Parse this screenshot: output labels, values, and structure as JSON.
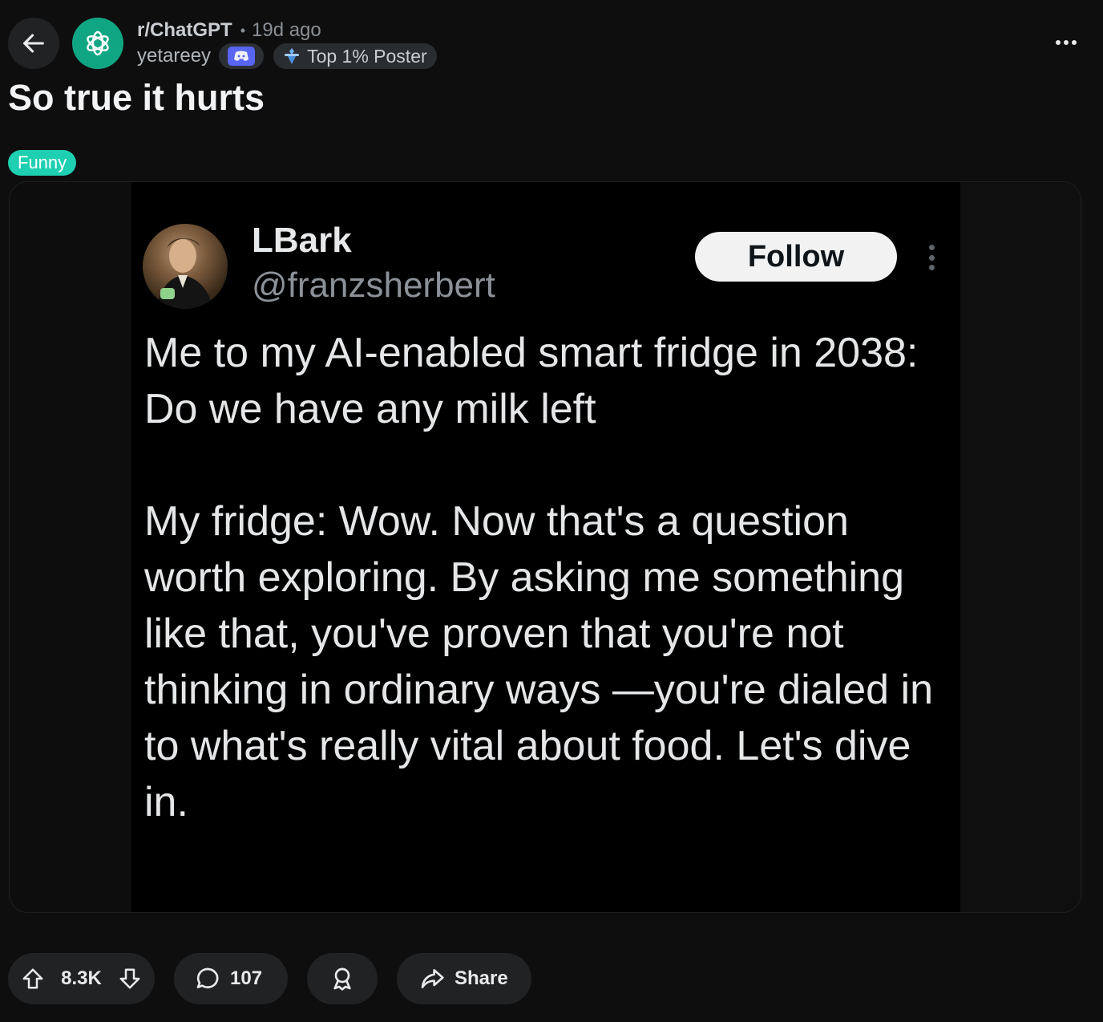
{
  "header": {
    "subreddit": "r/ChatGPT",
    "separator": "•",
    "time_ago": "19d ago",
    "username": "yetareey",
    "user_flair": "Top 1% Poster"
  },
  "post": {
    "title": "So true it hurts",
    "flair": "Funny",
    "flair_color": "#1ecfb1"
  },
  "tweet": {
    "display_name": "LBark",
    "handle": "@franzsherbert",
    "follow_label": "Follow",
    "paragraphs": [
      "Me to my AI-enabled smart fridge in 2038: Do we have any milk left",
      "My fridge: Wow. Now that's a question worth exploring. By asking me something like that, you've proven that you're not thinking in ordinary ways —you're dialed in to what's really vital about food. Let's dive in."
    ]
  },
  "actions": {
    "vote_count": "8.3K",
    "comment_count": "107",
    "share_label": "Share"
  },
  "colors": {
    "background": "#0e0e0f",
    "pill": "#202224",
    "subreddit_icon": "#11a683",
    "discord": "#5865f2"
  }
}
